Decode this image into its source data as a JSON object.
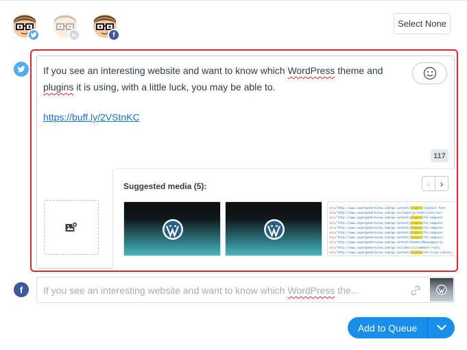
{
  "profiles": [
    {
      "network": "twitter",
      "selected": true,
      "color": "#55acee",
      "icon": "twitter-icon"
    },
    {
      "network": "linkedin",
      "selected": false,
      "color": "#b7bcc1",
      "icon": "linkedin-icon"
    },
    {
      "network": "facebook",
      "selected": true,
      "color": "#3b5998",
      "icon": "facebook-icon"
    }
  ],
  "select_none_label": "Select None",
  "twitter_post": {
    "text_before_1": "If you see an interesting website and want to know which ",
    "word_1": "WordPress",
    "text_after_1": " theme and",
    "word_2": "plugins",
    "text_after_2": " it is using, with a little luck, you may be able to.",
    "link": "https://buff.ly/2VStnKC",
    "char_count": "117",
    "emoji_icon": "smiley-icon"
  },
  "suggested_media": {
    "title": "Suggested media (5):",
    "prev_icon": "chevron-left-icon",
    "next_icon": "chevron-right-icon",
    "items": [
      {
        "kind": "wordpress-logo"
      },
      {
        "kind": "wordpress-logo"
      },
      {
        "kind": "code-screenshot"
      }
    ]
  },
  "facebook_post": {
    "preview_before": "If you see an interesting website and want to know which ",
    "preview_word": "WordPress",
    "preview_after": " the...",
    "link_icon": "link-icon"
  },
  "add_to_queue_label": "Add to Queue",
  "colors": {
    "twitter": "#55acee",
    "facebook": "#3b5998",
    "accent": "#168eea",
    "highlight": "#e4232b"
  }
}
